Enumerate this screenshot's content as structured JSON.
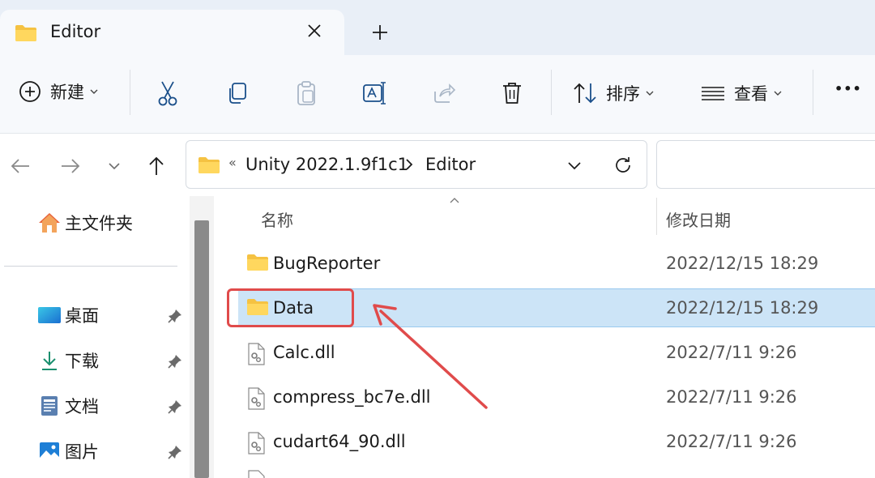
{
  "tab": {
    "title": "Editor",
    "new_tab_symbol": "+"
  },
  "toolbar": {
    "new_label": "新建",
    "sort_label": "排序",
    "view_label": "查看",
    "more_label": "•••"
  },
  "address": {
    "overflow": "«",
    "crumbs": [
      "Unity 2022.1.9f1c1",
      "Editor"
    ]
  },
  "sidebar": {
    "home": "主文件夹",
    "items": [
      {
        "label": "桌面",
        "icon": "desktop-icon"
      },
      {
        "label": "下载",
        "icon": "download-icon"
      },
      {
        "label": "文档",
        "icon": "document-icon"
      },
      {
        "label": "图片",
        "icon": "pictures-icon"
      }
    ]
  },
  "columns": {
    "name": "名称",
    "modified": "修改日期"
  },
  "files": [
    {
      "name": "BugReporter",
      "date": "2022/12/15 18:29",
      "type": "folder"
    },
    {
      "name": "Data",
      "date": "2022/12/15 18:29",
      "type": "folder",
      "selected": true
    },
    {
      "name": "Calc.dll",
      "date": "2022/7/11 9:26",
      "type": "dll"
    },
    {
      "name": "compress_bc7e.dll",
      "date": "2022/7/11 9:26",
      "type": "dll"
    },
    {
      "name": "cudart64_90.dll",
      "date": "2022/7/11 9:26",
      "type": "dll"
    }
  ],
  "colors": {
    "accent": "#005fb8",
    "selection": "#cce4f7",
    "annotation": "#e04b4b",
    "folder": "#f5c242"
  }
}
